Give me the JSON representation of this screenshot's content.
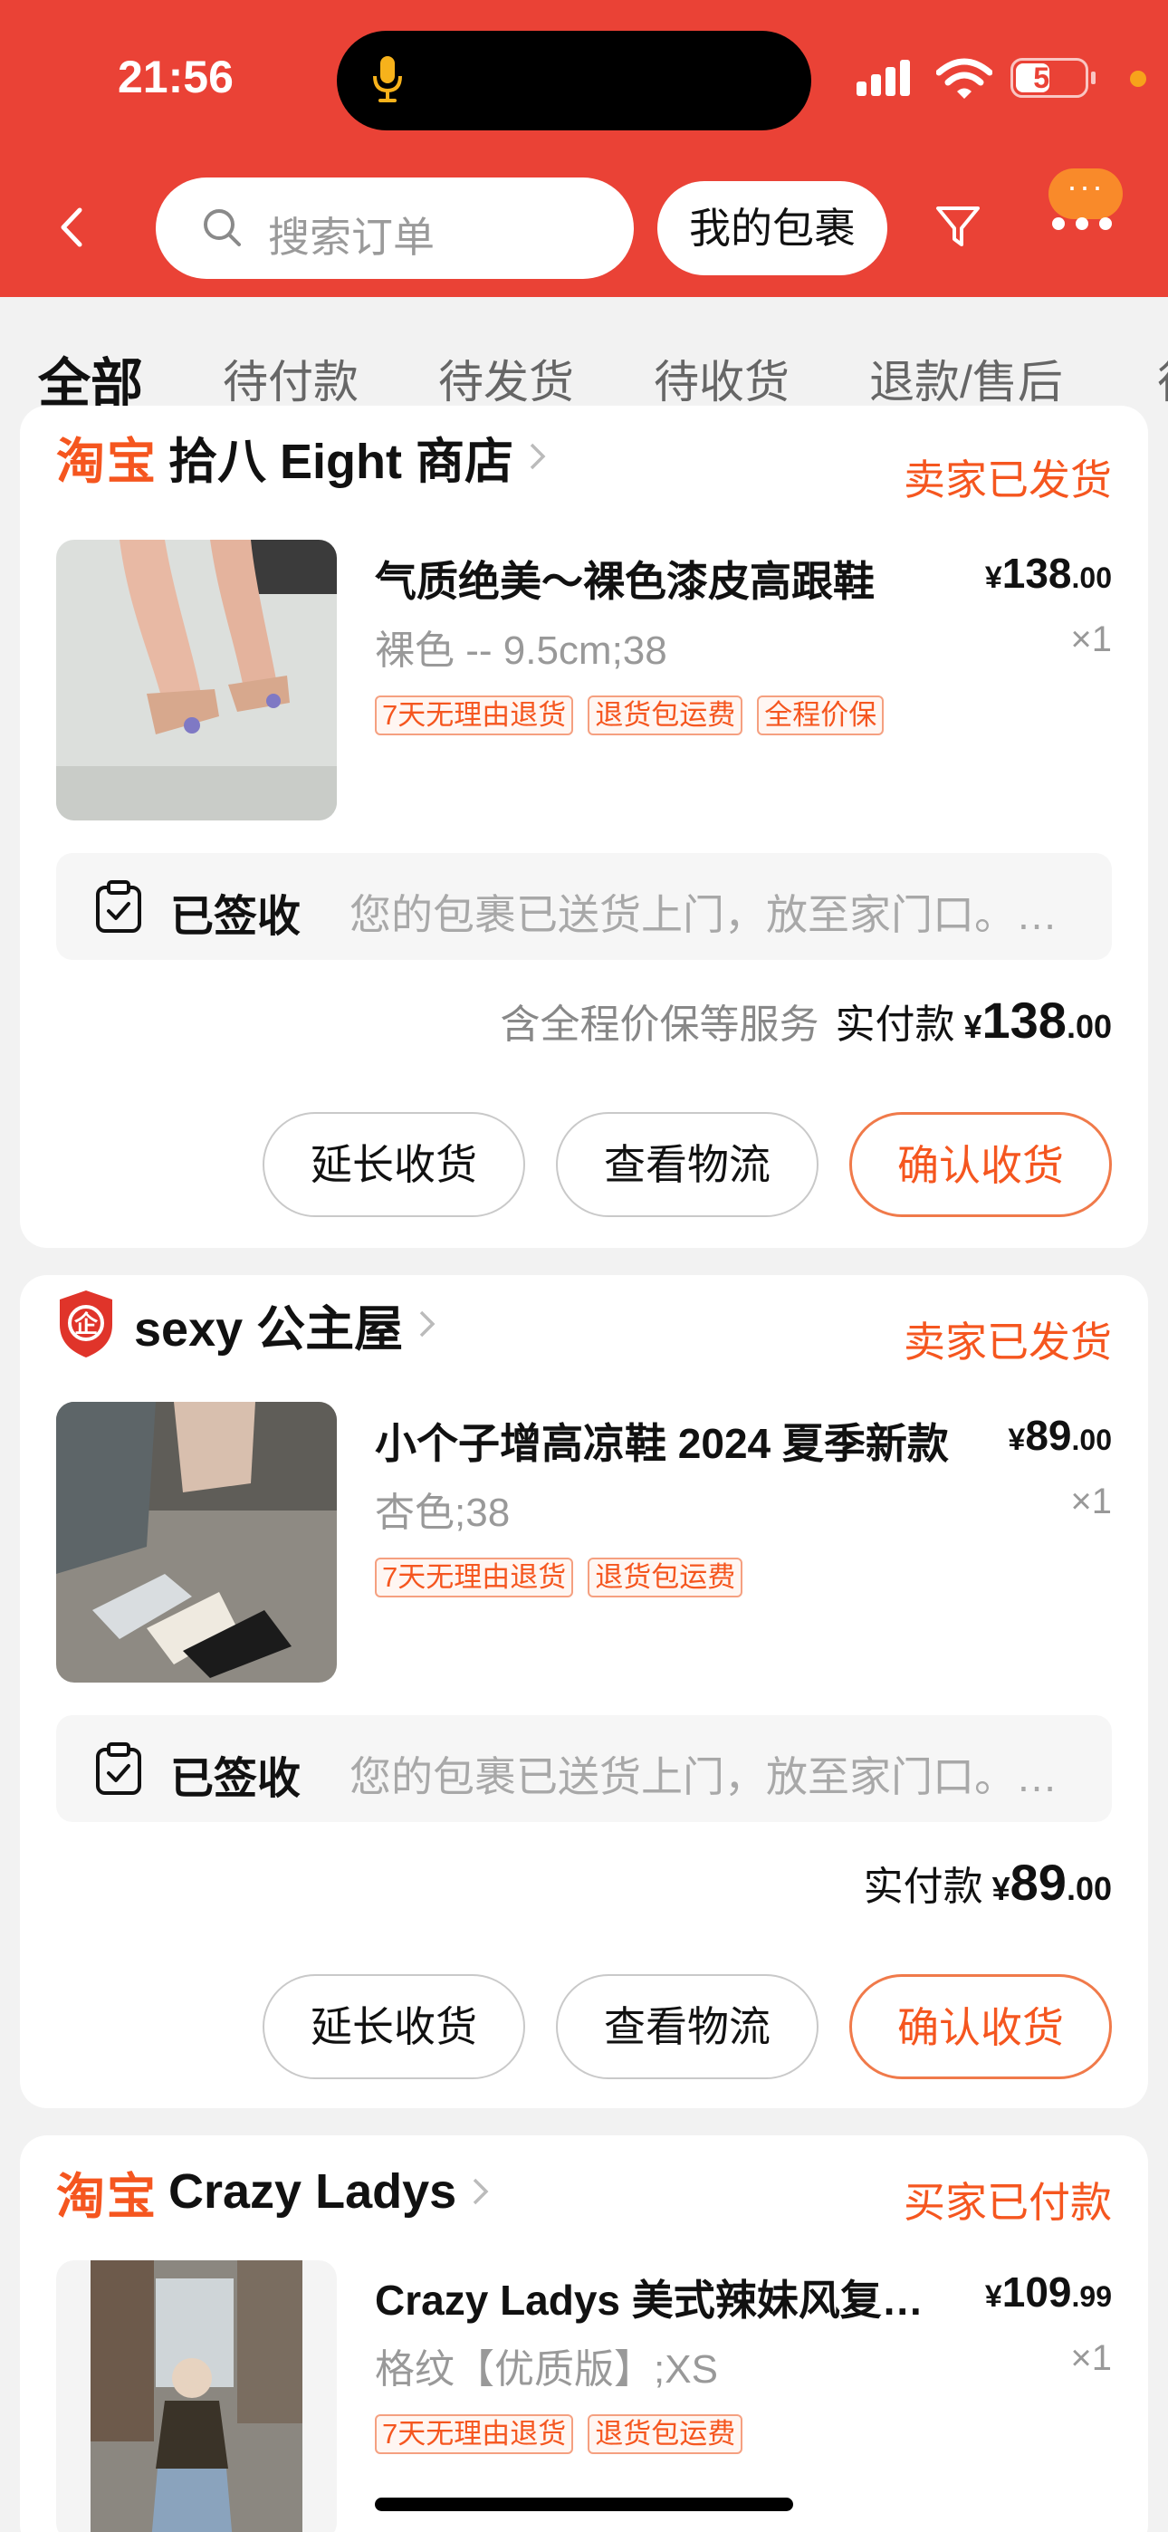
{
  "status_bar": {
    "time": "21:56",
    "battery": "50",
    "battery_level": 0.5
  },
  "header": {
    "search_placeholder": "搜索订单",
    "packages_button": "我的包裹",
    "more_label": "···"
  },
  "tabs": [
    "全部",
    "待付款",
    "待发货",
    "待收货",
    "退款/售后",
    "待"
  ],
  "orders": [
    {
      "platform_logo": "淘宝",
      "shop_name": "拾八 Eight 商店",
      "status": "卖家已发货",
      "title": "气质绝美～裸色漆皮高跟鞋",
      "price_yuan": "¥",
      "price_int": "138",
      "price_dec": ".00",
      "sku": "裸色 -- 9.5cm;38",
      "qty": "×1",
      "tags": [
        "7天无理由退货",
        "退货包运费",
        "全程价保"
      ],
      "logistics_state": "已签收",
      "logistics_text": "您的包裹已送货上门，放至家门口。您的包裹已送货上门",
      "pay_note": "含全程价保等服务",
      "pay_label": "实付款",
      "pay_yuan": "¥",
      "pay_int": "138",
      "pay_dec": ".00",
      "buttons": [
        "延长收货",
        "查看物流",
        "确认收货"
      ]
    },
    {
      "platform_logo": "企",
      "shop_name": "sexy 公主屋",
      "status": "卖家已发货",
      "title": "小个子增高凉鞋 2024 夏季新款",
      "price_yuan": "¥",
      "price_int": "89",
      "price_dec": ".00",
      "sku": "杏色;38",
      "qty": "×1",
      "tags": [
        "7天无理由退货",
        "退货包运费"
      ],
      "logistics_state": "已签收",
      "logistics_text": "您的包裹已送货上门，放至家门口。您的包裹已送货上门",
      "pay_note": "",
      "pay_label": "实付款",
      "pay_yuan": "¥",
      "pay_int": "89",
      "pay_dec": ".00",
      "buttons": [
        "延长收货",
        "查看物流",
        "确认收货"
      ]
    },
    {
      "platform_logo": "淘宝",
      "shop_name": "Crazy Ladys",
      "status": "买家已付款",
      "title": "Crazy Ladys 美式辣妹风复古牛仔",
      "price_yuan": "¥",
      "price_int": "109",
      "price_dec": ".99",
      "sku": "格纹【优质版】;XS",
      "qty": "×1",
      "tags": [
        "7天无理由退货",
        "退货包运费"
      ]
    }
  ],
  "colors": {
    "brand_red": "#ea4236",
    "accent_orange": "#f5561f",
    "bg": "#f2f2f2"
  }
}
